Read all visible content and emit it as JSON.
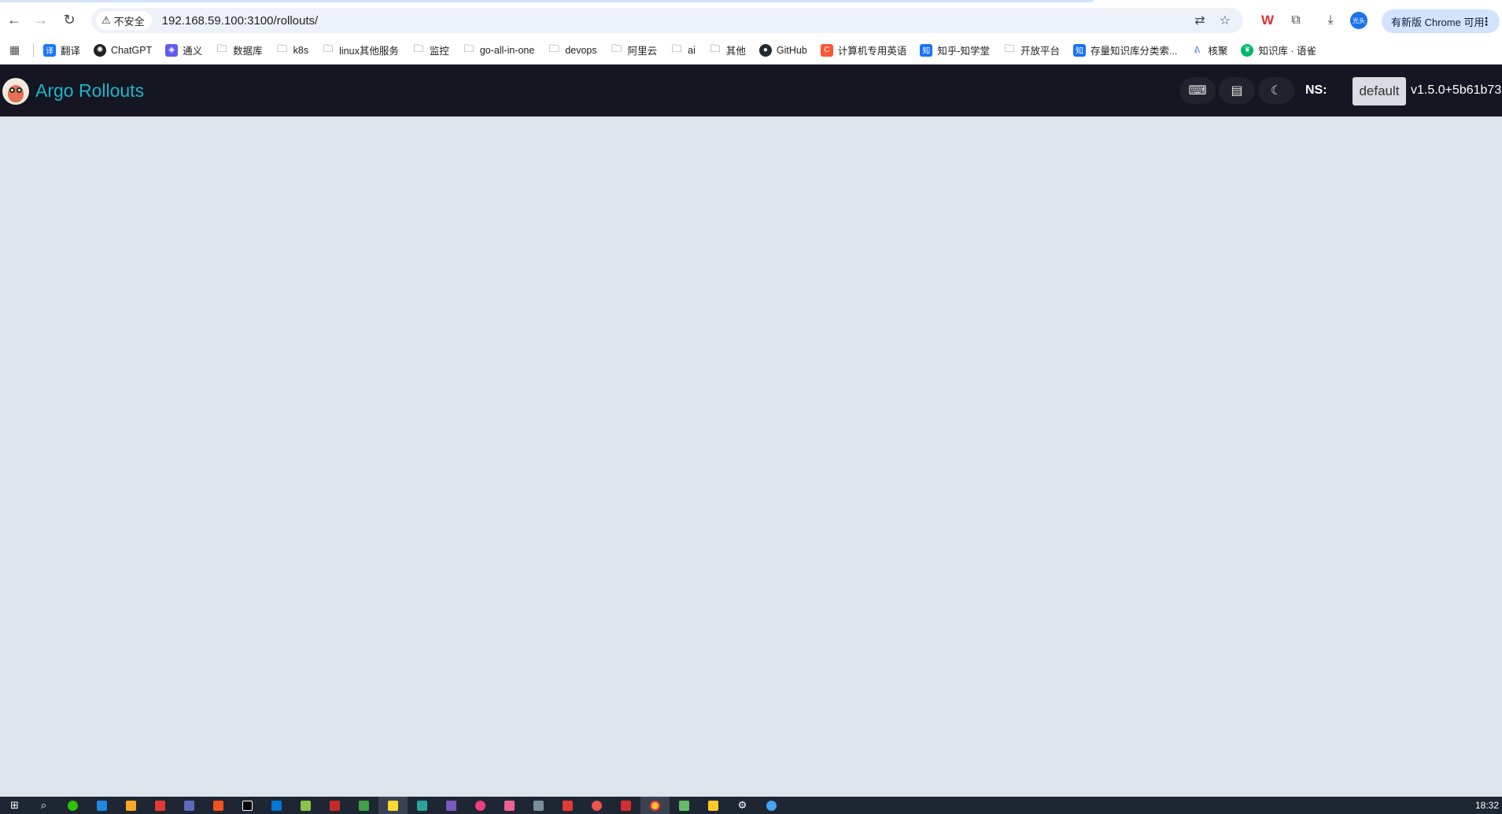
{
  "browser": {
    "url": "192.168.59.100:3100/rollouts/",
    "security_chip": "不安全",
    "update_label": "有新版 Chrome 可用",
    "bookmarks": [
      {
        "label": "翻译",
        "icon": "translate-icon"
      },
      {
        "label": "ChatGPT",
        "icon": "chatgpt-icon"
      },
      {
        "label": "通义",
        "icon": "tongyi-icon"
      },
      {
        "label": "数据库",
        "icon": "folder-icon"
      },
      {
        "label": "k8s",
        "icon": "folder-icon"
      },
      {
        "label": "linux其他服务",
        "icon": "folder-icon"
      },
      {
        "label": "监控",
        "icon": "folder-icon"
      },
      {
        "label": "go-all-in-one",
        "icon": "folder-icon"
      },
      {
        "label": "devops",
        "icon": "folder-icon"
      },
      {
        "label": "阿里云",
        "icon": "folder-icon"
      },
      {
        "label": "ai",
        "icon": "folder-icon"
      },
      {
        "label": "其他",
        "icon": "folder-icon"
      },
      {
        "label": "GitHub",
        "icon": "github-icon"
      },
      {
        "label": "计算机专用英语",
        "icon": "csdn-icon"
      },
      {
        "label": "知乎-知学堂",
        "icon": "zhihu-icon"
      },
      {
        "label": "开放平台",
        "icon": "folder-icon"
      },
      {
        "label": "存量知识库分类索...",
        "icon": "zhihu-icon"
      },
      {
        "label": "核聚",
        "icon": "heju-icon"
      },
      {
        "label": "知识库 · 语雀",
        "icon": "yuque-icon"
      }
    ]
  },
  "app": {
    "brand": "Argo Rollouts",
    "ns_label": "NS:",
    "namespace": "default",
    "version": "v1.5.0+5b61b73"
  },
  "taskbar": {
    "clock": "18:32"
  }
}
